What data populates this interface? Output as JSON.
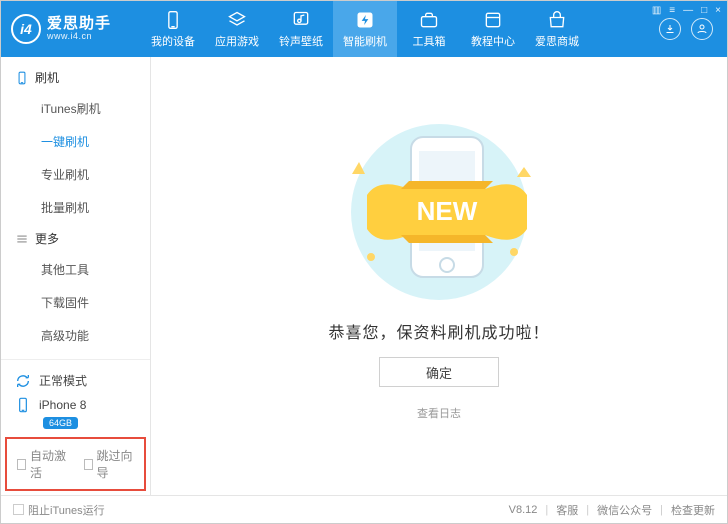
{
  "brand": {
    "name": "爱思助手",
    "url": "www.i4.cn",
    "icon_text": "i4"
  },
  "window_controls": [
    "▥",
    "≡",
    "—",
    "□",
    "×"
  ],
  "nav": [
    {
      "label": "我的设备",
      "icon": "phone"
    },
    {
      "label": "应用游戏",
      "icon": "apps"
    },
    {
      "label": "铃声壁纸",
      "icon": "music"
    },
    {
      "label": "智能刷机",
      "icon": "flash",
      "active": true
    },
    {
      "label": "工具箱",
      "icon": "toolbox"
    },
    {
      "label": "教程中心",
      "icon": "book"
    },
    {
      "label": "爱思商城",
      "icon": "shop"
    }
  ],
  "sidebar": {
    "groups": [
      {
        "title": "刷机",
        "icon": "phone",
        "items": [
          {
            "label": "iTunes刷机"
          },
          {
            "label": "一键刷机",
            "active": true
          },
          {
            "label": "专业刷机"
          },
          {
            "label": "批量刷机"
          }
        ]
      },
      {
        "title": "更多",
        "icon": "more",
        "items": [
          {
            "label": "其他工具"
          },
          {
            "label": "下载固件"
          },
          {
            "label": "高级功能"
          }
        ]
      }
    ],
    "mode": "正常模式",
    "device_name": "iPhone 8",
    "device_badge": "64GB",
    "options": [
      {
        "label": "自动激活"
      },
      {
        "label": "跳过向导"
      }
    ]
  },
  "main": {
    "new_ribbon": "NEW",
    "success_text": "恭喜您，保资料刷机成功啦！",
    "confirm_button": "确定",
    "view_log": "查看日志"
  },
  "footer": {
    "block_itunes": "阻止iTunes运行",
    "version": "V8.12",
    "links": [
      "客服",
      "微信公众号",
      "检查更新"
    ]
  }
}
